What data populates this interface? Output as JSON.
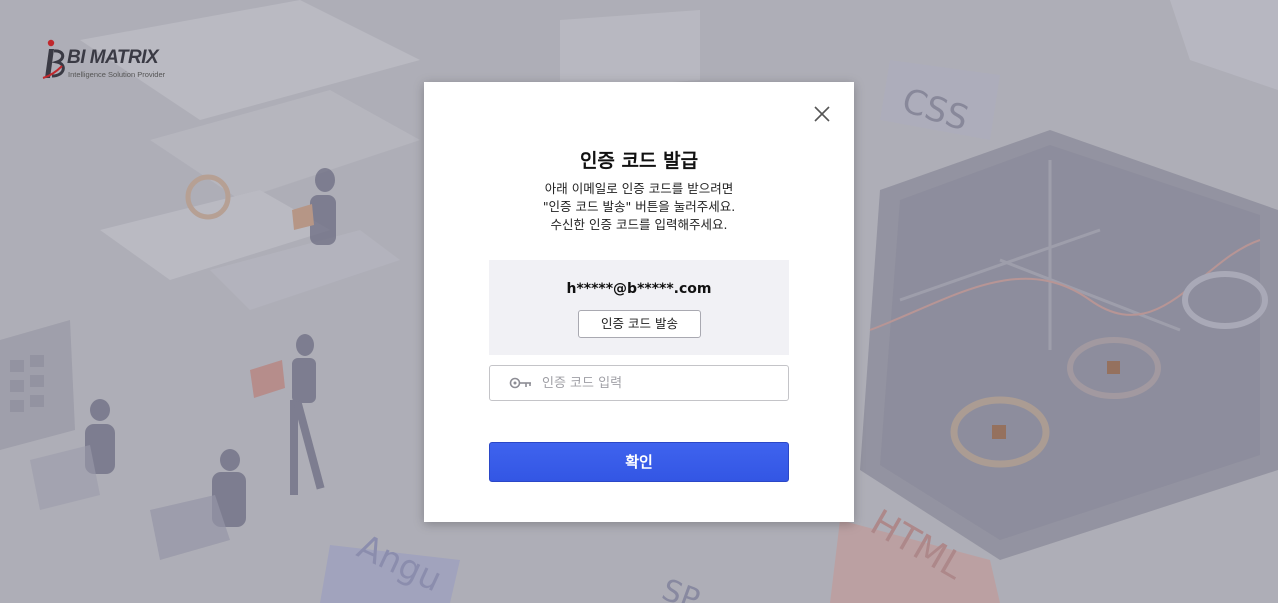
{
  "logo": {
    "brand": "BI MATRIX",
    "tagline": "Intelligence Solution Provider"
  },
  "background": {
    "tags": [
      "CSS",
      "HTML",
      "Angu",
      "SP"
    ]
  },
  "modal": {
    "title": "인증 코드 발급",
    "description": [
      "아래 이메일로 인증 코드를 받으려면",
      "\"인증 코드 발송\" 버튼을 눌러주세요.",
      "수신한 인증 코드를 입력해주세요."
    ],
    "masked_email": "h*****@b*****.com",
    "send_button_label": "인증 코드 발송",
    "code_input": {
      "placeholder": "인증 코드 입력",
      "value": ""
    },
    "confirm_button_label": "확인"
  },
  "colors": {
    "primary": "#3a5deb",
    "background": "#b9b9c1",
    "email_box": "#f1f1f5"
  },
  "icons": {
    "close": "close-icon",
    "key": "key-icon"
  }
}
